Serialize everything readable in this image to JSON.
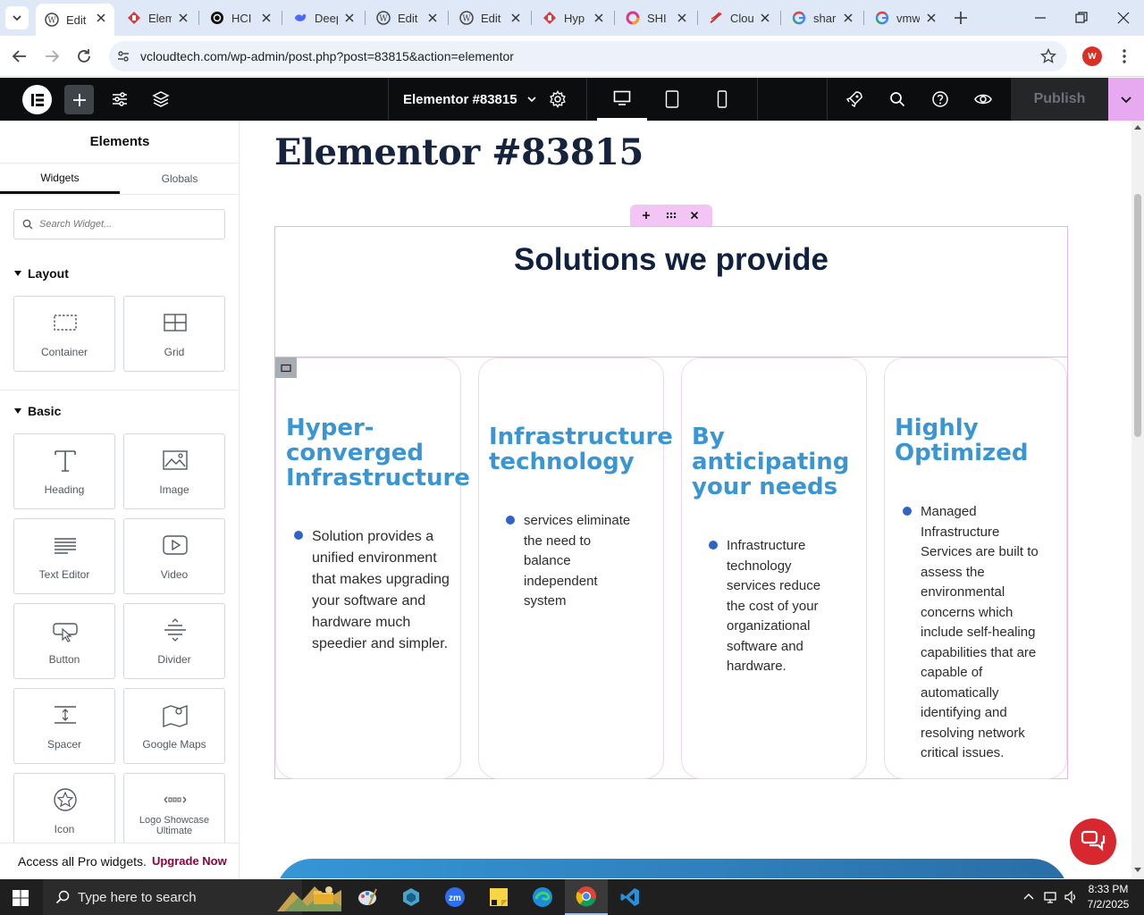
{
  "browser": {
    "tabs": [
      {
        "label": "Edit",
        "favicon": "wordpress-icon",
        "active": true
      },
      {
        "label": "Elementor",
        "favicon": "elementor-icon"
      },
      {
        "label": "HCI",
        "favicon": "openai-icon"
      },
      {
        "label": "DeepSeek",
        "favicon": "deepseek-icon"
      },
      {
        "label": "Edit",
        "favicon": "wordpress-icon"
      },
      {
        "label": "Edit",
        "favicon": "wordpress-icon"
      },
      {
        "label": "Hyp",
        "favicon": "elementor-icon"
      },
      {
        "label": "SHI",
        "favicon": "ring-icon"
      },
      {
        "label": "Clou",
        "favicon": "cloud-icon"
      },
      {
        "label": "shar",
        "favicon": "google-icon"
      },
      {
        "label": "vmw",
        "favicon": "google-icon"
      }
    ],
    "url": "vcloudtech.com/wp-admin/post.php?post=83815&action=elementor",
    "profile_initial": "W"
  },
  "editor": {
    "document_title": "Elementor #83815",
    "publish_label": "Publish"
  },
  "panel": {
    "title": "Elements",
    "tabs": [
      "Widgets",
      "Globals"
    ],
    "search_placeholder": "Search Widget...",
    "categories": {
      "layout": "Layout",
      "basic": "Basic"
    },
    "widgets": {
      "container": "Container",
      "grid": "Grid",
      "heading": "Heading",
      "image": "Image",
      "text_editor": "Text Editor",
      "video": "Video",
      "button": "Button",
      "divider": "Divider",
      "spacer": "Spacer",
      "google_maps": "Google Maps",
      "icon": "Icon",
      "logo_showcase": "Logo Showcase Ultimate"
    },
    "pro_text": "Access all Pro widgets.",
    "pro_link": "Upgrade Now"
  },
  "canvas": {
    "page_title": "Elementor #83815",
    "section_heading": "Solutions we provide",
    "cards": [
      {
        "title": "Hyper-\nconverged\nInfrastructure",
        "text": "Solution provides a unified environment that makes upgrading your software and hardware much speedier and simpler."
      },
      {
        "title": "Infrastructure\ntechnology",
        "text": "services eliminate the need to balance independent system"
      },
      {
        "title": "By\nanticipating\nyour needs",
        "text": "Infrastructure technology services reduce the cost of your organizational software and hardware."
      },
      {
        "title": "Highly\nOptimized",
        "text": "Managed Infrastructure Services are built to assess the environmental concerns which include self-healing capabilities that are capable of automatically identifying and resolving network critical issues."
      }
    ]
  },
  "taskbar": {
    "search_placeholder": "Type here to search",
    "time": "8:33 PM",
    "date": "7/2/2025"
  },
  "colors": {
    "card_title": "#3a95d3",
    "section_border": "#e7b4f0",
    "publish_dropdown": "#e7a9f0",
    "upgrade_link": "#93003c"
  }
}
